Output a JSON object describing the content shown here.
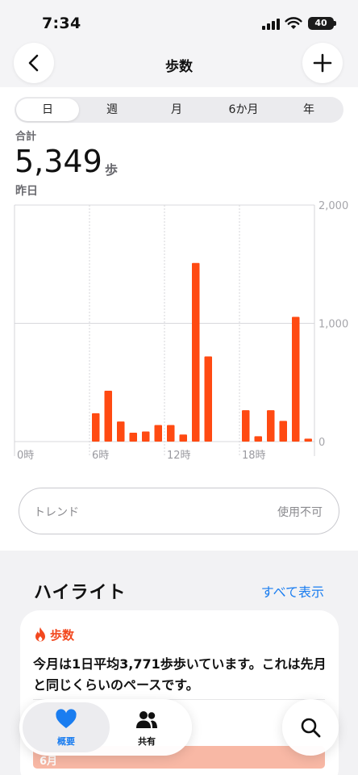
{
  "status_bar": {
    "time": "7:34",
    "battery": "40"
  },
  "nav": {
    "title": "歩数"
  },
  "range_tabs": [
    {
      "label": "日",
      "selected": true
    },
    {
      "label": "週",
      "selected": false
    },
    {
      "label": "月",
      "selected": false
    },
    {
      "label": "6か月",
      "selected": false
    },
    {
      "label": "年",
      "selected": false
    }
  ],
  "summary": {
    "label": "合計",
    "value": "5,349",
    "unit": "歩",
    "date": "昨日"
  },
  "chart_data": {
    "type": "bar",
    "x_tick_labels": [
      "0時",
      "6時",
      "12時",
      "18時"
    ],
    "y_tick_labels": [
      "2,000",
      "1,000",
      "0"
    ],
    "ylim": [
      0,
      2000
    ],
    "categories": [
      "0",
      "1",
      "2",
      "3",
      "4",
      "5",
      "6",
      "7",
      "8",
      "9",
      "10",
      "11",
      "12",
      "13",
      "14",
      "15",
      "16",
      "17",
      "18",
      "19",
      "20",
      "21",
      "22",
      "23"
    ],
    "values": [
      0,
      0,
      0,
      0,
      0,
      0,
      240,
      430,
      170,
      75,
      85,
      140,
      140,
      60,
      1510,
      720,
      0,
      0,
      265,
      45,
      265,
      175,
      1055,
      25
    ],
    "color": "#ff4a12",
    "grid": true
  },
  "trend": {
    "label": "トレンド",
    "status": "使用不可"
  },
  "highlights": {
    "title": "ハイライト",
    "show_all": "すべて表示",
    "card": {
      "category": "歩数",
      "text": "今月は1日平均3,771歩歩いています。これは先月と同じくらいのペースです。",
      "bar_label": "6月"
    }
  },
  "tabbar": {
    "summary_label": "概要",
    "sharing_label": "共有"
  },
  "colors": {
    "accent_orange": "#f2481f",
    "link_blue": "#1a7df0",
    "bar": "#ff4a12"
  }
}
